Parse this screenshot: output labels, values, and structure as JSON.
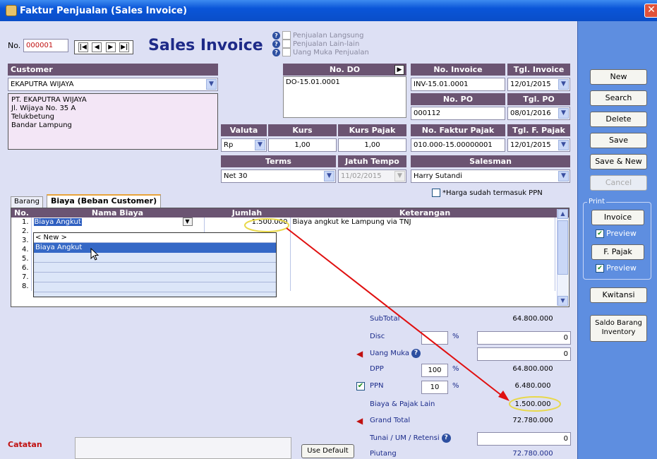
{
  "window": {
    "title": "Faktur Penjualan (Sales Invoice)"
  },
  "header": {
    "no_label": "No.",
    "no_value": "000001",
    "title": "Sales Invoice",
    "type_options": [
      {
        "label": "Penjualan Langsung"
      },
      {
        "label": "Penjualan Lain-lain"
      },
      {
        "label": "Uang Muka Penjualan"
      }
    ]
  },
  "customer": {
    "header": "Customer",
    "name": "EKAPUTRA WIJAYA",
    "address": [
      "PT. EKAPUTRA WIJAYA",
      "Jl. Wijaya No. 35 A",
      "Telukbetung",
      "Bandar Lampung"
    ]
  },
  "do": {
    "header": "No. DO",
    "value": "DO-15.01.0001"
  },
  "invoice": {
    "header": "No. Invoice",
    "value": "INV-15.01.0001",
    "date_header": "Tgl. Invoice",
    "date": "12/01/2015"
  },
  "po": {
    "header": "No. PO",
    "value": "000112",
    "date_header": "Tgl. PO",
    "date": "08/01/2016"
  },
  "valuta": {
    "header": "Valuta",
    "value": "Rp"
  },
  "kurs": {
    "header": "Kurs",
    "value": "1,00"
  },
  "kurs_pajak": {
    "header": "Kurs Pajak",
    "value": "1,00"
  },
  "faktur_pajak": {
    "header": "No. Faktur Pajak",
    "value": "010.000-15.00000001",
    "date_header": "Tgl. F. Pajak",
    "date": "12/01/2015"
  },
  "terms": {
    "header": "Terms",
    "value": "Net 30"
  },
  "jatuh_tempo": {
    "header": "Jatuh Tempo",
    "value": "11/02/2015"
  },
  "salesman": {
    "header": "Salesman",
    "value": "Harry Sutandi"
  },
  "ppn_included_label": "*Harga sudah termasuk PPN",
  "tabs": [
    {
      "label": "Barang"
    },
    {
      "label": "Biaya (Beban Customer)"
    }
  ],
  "grid": {
    "columns": [
      "No.",
      "Nama Biaya",
      "Jumlah",
      "Keterangan"
    ],
    "rows": [
      {
        "no": "1.",
        "nama": "Biaya Angkut",
        "jumlah": "1.500.000",
        "keterangan": "Biaya angkut ke Lampung via TNJ"
      },
      {
        "no": "2."
      },
      {
        "no": "3."
      },
      {
        "no": "4."
      },
      {
        "no": "5."
      },
      {
        "no": "6."
      },
      {
        "no": "7."
      },
      {
        "no": "8."
      }
    ],
    "dropdown_items": [
      "< New >",
      "Biaya Angkut"
    ]
  },
  "totals": {
    "subtotal_label": "SubTotal",
    "subtotal": "64.800.000",
    "disc_label": "Disc",
    "disc_pct": "",
    "disc_pct_symbol": "%",
    "disc_value": "0",
    "um_label": "Uang Muka",
    "um_value": "0",
    "dpp_label": "DPP",
    "dpp_pct": "100",
    "dpp_pct_symbol": "%",
    "dpp_value": "64.800.000",
    "ppn_label": "PPN",
    "ppn_pct": "10",
    "ppn_pct_symbol": "%",
    "ppn_value": "6.480.000",
    "biaya_label": "Biaya & Pajak Lain",
    "biaya_value": "1.500.000",
    "grand_label": "Grand Total",
    "grand_value": "72.780.000",
    "tunai_label": "Tunai / UM / Retensi",
    "tunai_value": "0",
    "piutang_label": "Piutang",
    "piutang_value": "72.780.000"
  },
  "catatan_label": "Catatan",
  "use_default_label": "Use Default",
  "side": {
    "new": "New",
    "search": "Search",
    "delete": "Delete",
    "save": "Save",
    "save_new": "Save & New",
    "cancel": "Cancel",
    "print_group": "Print",
    "invoice": "Invoice",
    "preview1": "Preview",
    "fpajak": "F. Pajak",
    "preview2": "Preview",
    "kwitansi": "Kwitansi",
    "saldo": "Saldo Barang Inventory"
  },
  "colors": {
    "header_bg": "#6b5472",
    "panel_bg": "#dde0f4",
    "side_bg": "#5e8ee0",
    "annotation_red": "#e01010",
    "highlight_yellow": "#e8d84a"
  }
}
